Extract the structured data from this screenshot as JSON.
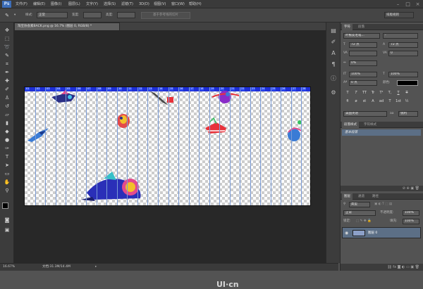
{
  "app": {
    "logo": "Ps"
  },
  "menu": [
    "文件(F)",
    "编辑(E)",
    "图像(I)",
    "图层(L)",
    "文字(Y)",
    "选择(S)",
    "滤镜(T)",
    "3D(D)",
    "视图(V)",
    "窗口(W)",
    "帮助(H)"
  ],
  "window_buttons": [
    "–",
    "□",
    "×"
  ],
  "options": {
    "style_label": "样式:",
    "style_value": "正常",
    "width_label": "宽度:",
    "height_label": "高度:",
    "guides_button": "基于参考线的切片",
    "workspace": "排版规则"
  },
  "document": {
    "tab_title": "淘宝协会素BACK.png @ 16.7% (图层 0, RGB/8) *",
    "slice_labels": [
      "01",
      "02",
      "03",
      "04",
      "05",
      "06",
      "07",
      "08",
      "09",
      "10",
      "11",
      "12",
      "13",
      "14",
      "15",
      "16",
      "17",
      "18",
      "19",
      "20",
      "21",
      "22",
      "23",
      "24",
      "25",
      "26",
      "27",
      "28"
    ],
    "zoom": "16.67%",
    "doc_info": "文档:31.3M/14.4M"
  },
  "watermark": "UI·cn",
  "character_panel": {
    "tabs": [
      "字符",
      "段落"
    ],
    "font_family": "叶根友毛笔...",
    "font_style": "-",
    "font_size": "72 点",
    "leading": "72 点",
    "kerning": "",
    "tracking": "0",
    "scale_pct": "0%",
    "vertical_scale": "100%",
    "horizontal_scale": "100%",
    "baseline": "0 点",
    "color_label": "颜色:",
    "color_swatch": "#000000",
    "style_buttons": [
      "T",
      "T",
      "TT",
      "Tr",
      "T¹",
      "T,",
      "T",
      "T"
    ],
    "extra_buttons": [
      "fi",
      "ø",
      "st",
      "A",
      "ad",
      "T",
      "1st",
      "½"
    ],
    "language": "美国英语",
    "antialias_icon": "aa-icon",
    "antialias": "锐利"
  },
  "paragraph_styles": {
    "tabs": [
      "段落样式",
      "字符样式"
    ],
    "items": [
      "基本段落"
    ]
  },
  "layers_panel": {
    "tabs": [
      "图层",
      "通道",
      "路径"
    ],
    "filter_label": "类型",
    "blend_mode": "正常",
    "opacity_label": "不透明度:",
    "opacity_value": "100%",
    "lock_label": "锁定:",
    "fill_label": "填充:",
    "fill_value": "100%",
    "layers": [
      {
        "name": "图层 0",
        "visible": true
      }
    ]
  }
}
